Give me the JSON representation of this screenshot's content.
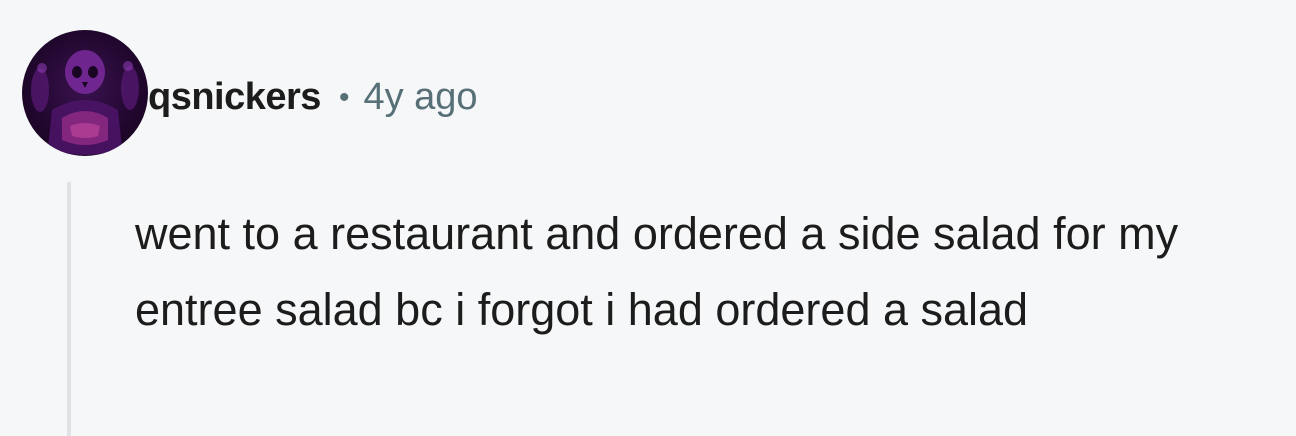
{
  "comment": {
    "username": "qsnickers",
    "separator": "•",
    "timestamp": "4y ago",
    "avatar_icon": "purple-skull-avatar",
    "body": "went to a restaurant and ordered a side salad for my entree salad bc i forgot i had ordered a salad"
  },
  "colors": {
    "background": "#f6f7f8",
    "username": "#1c1c1c",
    "meta": "#576f76",
    "thread_line": "#dfe3e6",
    "avatar_accent": "#7a2a9c"
  }
}
